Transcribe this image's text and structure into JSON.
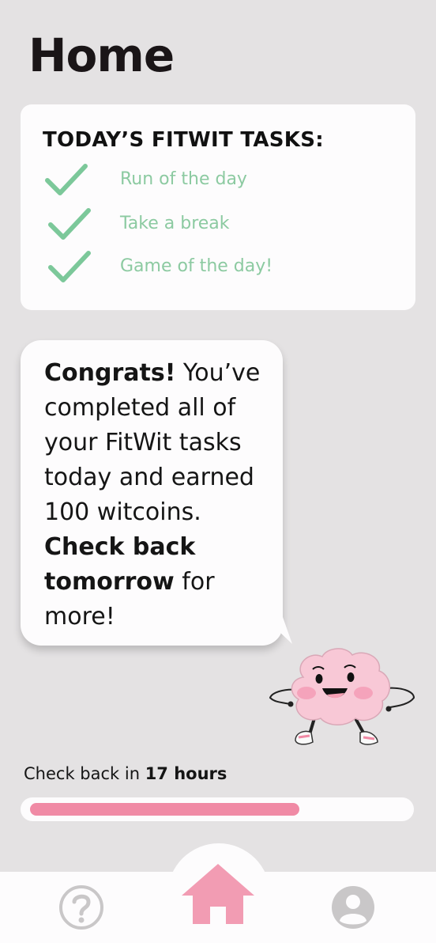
{
  "page": {
    "title": "Home"
  },
  "tasks_card": {
    "heading": "TODAY’S FITWIT TASKS:",
    "items": [
      {
        "label": "Run of the day",
        "completed": true,
        "icon": "checkmark-icon"
      },
      {
        "label": "Take a break",
        "completed": true,
        "icon": "checkmark-icon"
      },
      {
        "label": "Game of the day!",
        "completed": true,
        "icon": "checkmark-icon"
      }
    ]
  },
  "message": {
    "congrats": "Congrats!",
    "body": " You’ve completed all of your FitWit tasks today and earned 100 witcoins. ",
    "cta_bold": "Check back tomorrow",
    "cta_rest": " for more!"
  },
  "countdown": {
    "prefix": "Check back in ",
    "value": "17 hours"
  },
  "progress": {
    "fraction": 0.72
  },
  "tabbar": {
    "items": [
      {
        "name": "help",
        "icon": "question-mark-icon"
      },
      {
        "name": "home",
        "icon": "house-icon",
        "active": true
      },
      {
        "name": "profile",
        "icon": "user-icon"
      }
    ]
  },
  "colors": {
    "background": "#e4e2e3",
    "card": "#fdfcfd",
    "accent_pink": "#f08aa5",
    "check_green": "#7cc89a",
    "tab_inactive": "#c9c7c8"
  }
}
